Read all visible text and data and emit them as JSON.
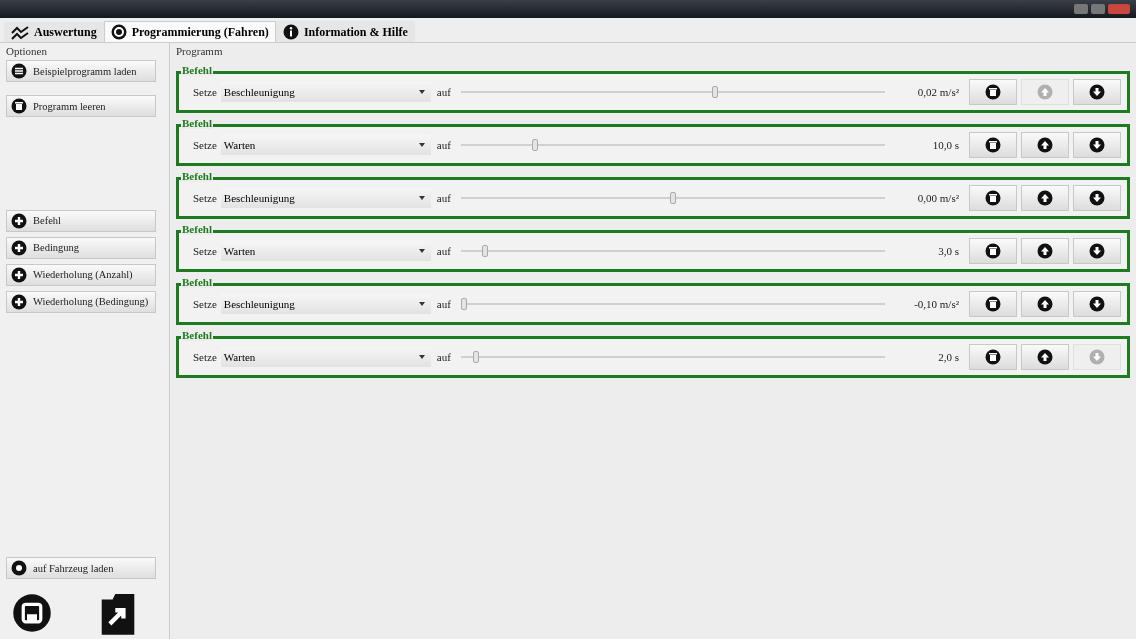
{
  "tabs": [
    {
      "label": "Auswertung",
      "selected": false
    },
    {
      "label": "Programmierung (Fahren)",
      "selected": true
    },
    {
      "label": "Information & Hilfe",
      "selected": false
    }
  ],
  "sidebar": {
    "title": "Optionen",
    "top_buttons": [
      "Beispielprogramm laden",
      "Programm leeren"
    ],
    "add_buttons": [
      "Befehl",
      "Bedingung",
      "Wiederholung (Anzahl)",
      "Wiederholung (Bedingung)"
    ],
    "upload_button": "auf Fahrzeug laden"
  },
  "program": {
    "title": "Programm",
    "commands": [
      {
        "label": "Befehl",
        "prefix": "Setze",
        "action": "Beschleunigung",
        "connector": "auf",
        "level": 0.6,
        "reading": "0,02 m/s²",
        "up_disabled": true,
        "down_disabled": false
      },
      {
        "label": "Befehl",
        "prefix": "Setze",
        "action": "Warten",
        "connector": "auf",
        "level": 0.17,
        "reading": "10,0 s",
        "up_disabled": false,
        "down_disabled": false
      },
      {
        "label": "Befehl",
        "prefix": "Setze",
        "action": "Beschleunigung",
        "connector": "auf",
        "level": 0.5,
        "reading": "0,00 m/s²",
        "up_disabled": false,
        "down_disabled": false
      },
      {
        "label": "Befehl",
        "prefix": "Setze",
        "action": "Warten",
        "connector": "auf",
        "level": 0.05,
        "reading": "3,0 s",
        "up_disabled": false,
        "down_disabled": false
      },
      {
        "label": "Befehl",
        "prefix": "Setze",
        "action": "Beschleunigung",
        "connector": "auf",
        "level": 0.0,
        "reading": "-0,10 m/s²",
        "up_disabled": false,
        "down_disabled": false
      },
      {
        "label": "Befehl",
        "prefix": "Setze",
        "action": "Warten",
        "connector": "auf",
        "level": 0.03,
        "reading": "2,0 s",
        "up_disabled": false,
        "down_disabled": true
      }
    ]
  }
}
